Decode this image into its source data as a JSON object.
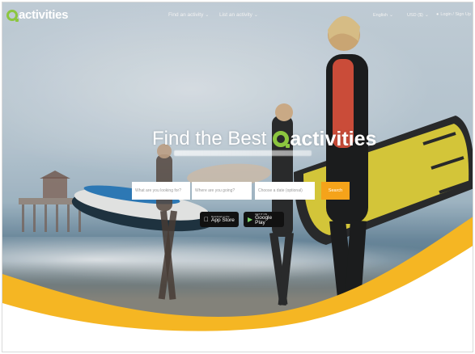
{
  "header": {
    "logo_text": "activities",
    "nav": [
      {
        "label": "Find an activity",
        "icon": "chevron-down-icon"
      },
      {
        "label": "List an activity",
        "icon": "chevron-down-icon"
      }
    ],
    "right": {
      "language": "English",
      "currency": "USD ($)",
      "account": "Login / Sign Up"
    }
  },
  "hero": {
    "headline_prefix": "Find the Best",
    "headline_brand": "activities",
    "search": {
      "what_placeholder": "What are you looking for?",
      "where_placeholder": "Where are you going?",
      "when_placeholder": "Choose a date (optional)",
      "button_label": "Search"
    },
    "apps": {
      "appstore_small": "Download on the",
      "appstore_big": "App Store",
      "googleplay_small": "GET IT ON",
      "googleplay_big": "Google Play"
    }
  },
  "colors": {
    "brand_green": "#8cc63f",
    "accent_yellow": "#f5b623",
    "search_orange": "#f5a31a"
  }
}
